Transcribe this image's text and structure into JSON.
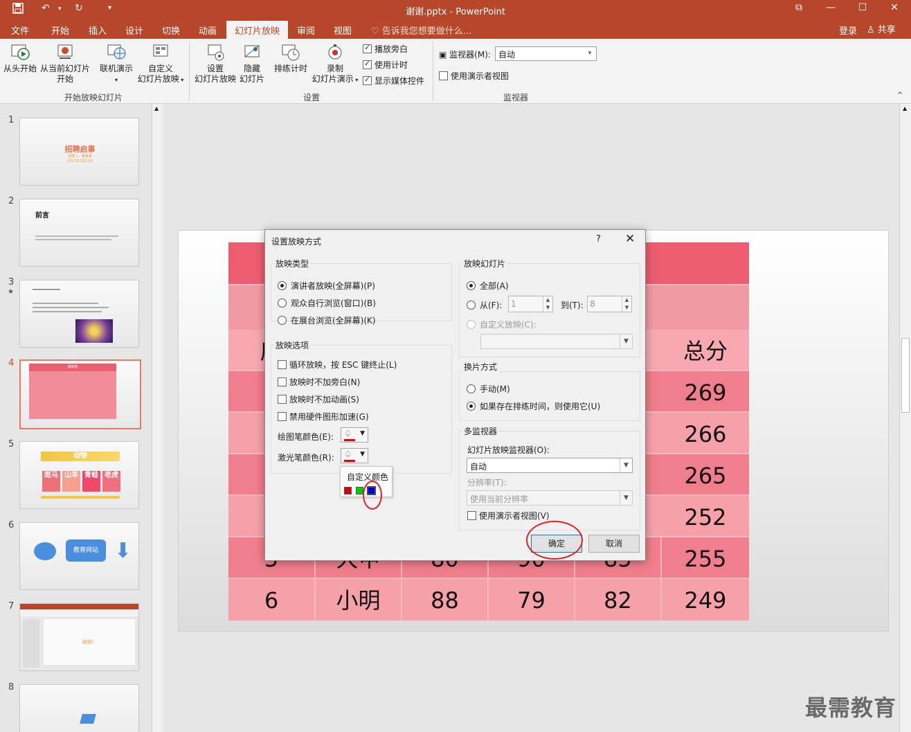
{
  "window": {
    "title": "谢谢.pptx - PowerPoint",
    "quick_access": [
      "save-icon",
      "undo-icon",
      "redo-icon",
      "customize-icon"
    ],
    "controls": [
      "ribbon-display-icon",
      "minimize-icon",
      "maximize-icon",
      "close-icon"
    ]
  },
  "tabs": {
    "items": [
      "文件",
      "开始",
      "插入",
      "设计",
      "切换",
      "动画",
      "幻灯片放映",
      "审阅",
      "视图"
    ],
    "active": "幻灯片放映",
    "tellme": "告诉我您想要做什么...",
    "login": "登录",
    "share": "共享"
  },
  "ribbon": {
    "start_group": {
      "label": "开始放映幻灯片",
      "from_start": "从头开始",
      "from_current_1": "从当前幻灯片",
      "from_current_2": "开始",
      "online_1": "联机演示",
      "custom_1": "自定义",
      "custom_2": "幻灯片放映"
    },
    "setup_group": {
      "label": "设置",
      "setup_1": "设置",
      "setup_2": "幻灯片放映",
      "hide_1": "隐藏",
      "hide_2": "幻灯片",
      "rehearse": "排练计时",
      "record_1": "录制",
      "record_2": "幻灯片演示",
      "chk_narration": "播放旁白",
      "chk_timing": "使用计时",
      "chk_media": "显示媒体控件"
    },
    "monitor_group": {
      "label": "监视器",
      "monitor_label": "监视器(M):",
      "monitor_value": "自动",
      "presenter_view": "使用演示者视图"
    }
  },
  "thumbnails": [
    {
      "num": "1",
      "title": "招聘启事",
      "sub1": "招聘人：某某某",
      "sub2": "2017年1月12日"
    },
    {
      "num": "2",
      "title": "前言"
    },
    {
      "num": "3",
      "star": "★"
    },
    {
      "num": "4",
      "title": "成绩表",
      "selected": true
    },
    {
      "num": "5",
      "title": "动物",
      "cards": [
        "斑马",
        "山羊",
        "青蛙",
        "老虎"
      ]
    },
    {
      "num": "6",
      "button": "教育网站"
    },
    {
      "num": "7",
      "text": "谢谢！"
    },
    {
      "num": "8"
    }
  ],
  "slide": {
    "header": [
      "序",
      "",
      "",
      "",
      "",
      "总分"
    ],
    "rows": [
      [
        "",
        "",
        "",
        "",
        "",
        "269"
      ],
      [
        "",
        "",
        "",
        "",
        "",
        "266"
      ],
      [
        "",
        "",
        "",
        "",
        "",
        "265"
      ],
      [
        "",
        "",
        "",
        "",
        "",
        "252"
      ],
      [
        "5",
        "大甲",
        "80",
        "90",
        "85",
        "255"
      ],
      [
        "6",
        "小明",
        "88",
        "79",
        "82",
        "249"
      ]
    ]
  },
  "dialog": {
    "title": "设置放映方式",
    "help": "?",
    "show_type": {
      "label": "放映类型",
      "opt1": "演讲者放映(全屏幕)(P)",
      "opt2": "观众自行浏览(窗口)(B)",
      "opt3": "在展台浏览(全屏幕)(K)"
    },
    "show_options": {
      "label": "放映选项",
      "loop": "循环放映，按 ESC 键终止(L)",
      "no_narration": "放映时不加旁白(N)",
      "no_animation": "放映时不加动画(S)",
      "no_hw_accel": "禁用硬件图形加速(G)",
      "pen_color": "绘图笔颜色(E):",
      "laser_color": "激光笔颜色(R):"
    },
    "slides": {
      "label": "放映幻灯片",
      "all": "全部(A)",
      "from": "从(F):",
      "from_value": "1",
      "to": "到(T):",
      "to_value": "8",
      "custom": "自定义放映(C):"
    },
    "advance": {
      "label": "换片方式",
      "manual": "手动(M)",
      "timing": "如果存在排练时间，则使用它(U)"
    },
    "multi_monitor": {
      "label": "多监视器",
      "monitor_label": "幻灯片放映监视器(O):",
      "monitor_value": "自动",
      "resolution_label": "分辨率(T):",
      "resolution_value": "使用当前分辨率",
      "presenter_view": "使用演示者视图(V)"
    },
    "ok": "确定",
    "cancel": "取消",
    "color_popup": {
      "label": "自定义颜色",
      "swatches": [
        "#e00000",
        "#00d000",
        "#0000e0"
      ]
    }
  },
  "watermark": "最需教育"
}
